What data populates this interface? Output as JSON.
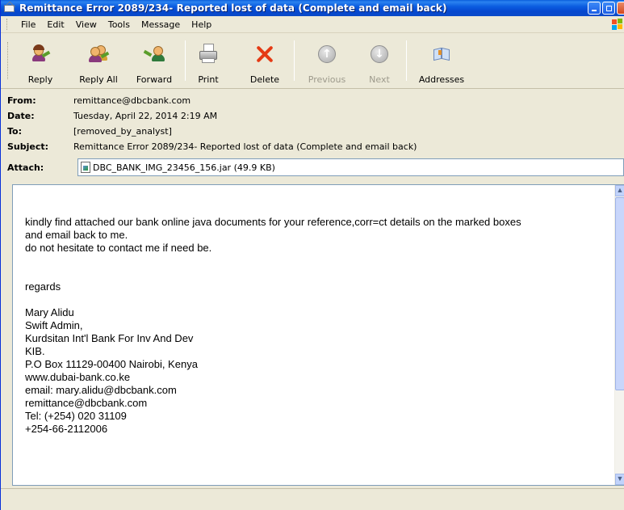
{
  "window": {
    "title": "Remittance Error 2089/234- Reported lost of data (Complete and email back)"
  },
  "menu": [
    "File",
    "Edit",
    "View",
    "Tools",
    "Message",
    "Help"
  ],
  "toolbar": {
    "reply": "Reply",
    "reply_all": "Reply All",
    "forward": "Forward",
    "print": "Print",
    "delete": "Delete",
    "previous": "Previous",
    "next": "Next",
    "addresses": "Addresses"
  },
  "header": {
    "from_label": "From:",
    "from": "remittance@dbcbank.com",
    "date_label": "Date:",
    "date": "Tuesday, April 22, 2014 2:19 AM",
    "to_label": "To:",
    "to": "[removed_by_analyst]",
    "subject_label": "Subject:",
    "subject": "Remittance Error 2089/234- Reported lost of data (Complete and email back)",
    "attach_label": "Attach:",
    "attachment": "DBC_BANK_IMG_23456_156.jar (49.9 KB)"
  },
  "body": {
    "lines": [
      "kindly find attached our bank online java documents for your reference,corr=ct details on the marked boxes",
      "and email back to me.",
      "do not hesitate to contact me if need be.",
      "",
      "",
      "regards",
      "",
      "Mary Alidu",
      "Swift Admin,",
      "Kurdsitan Int'l Bank For Inv And Dev",
      "KIB.",
      "P.O Box 11129-00400 Nairobi, Kenya",
      "www.dubai-bank.co.ke",
      "email: mary.alidu@dbcbank.com",
      "remittance@dbcbank.com",
      "Tel: (+254) 020 31109",
      "+254-66-2112006"
    ]
  },
  "colors": {
    "titlebar": "#0648cf",
    "delete_x": "#e53a14",
    "chrome": "#ece9d8"
  }
}
